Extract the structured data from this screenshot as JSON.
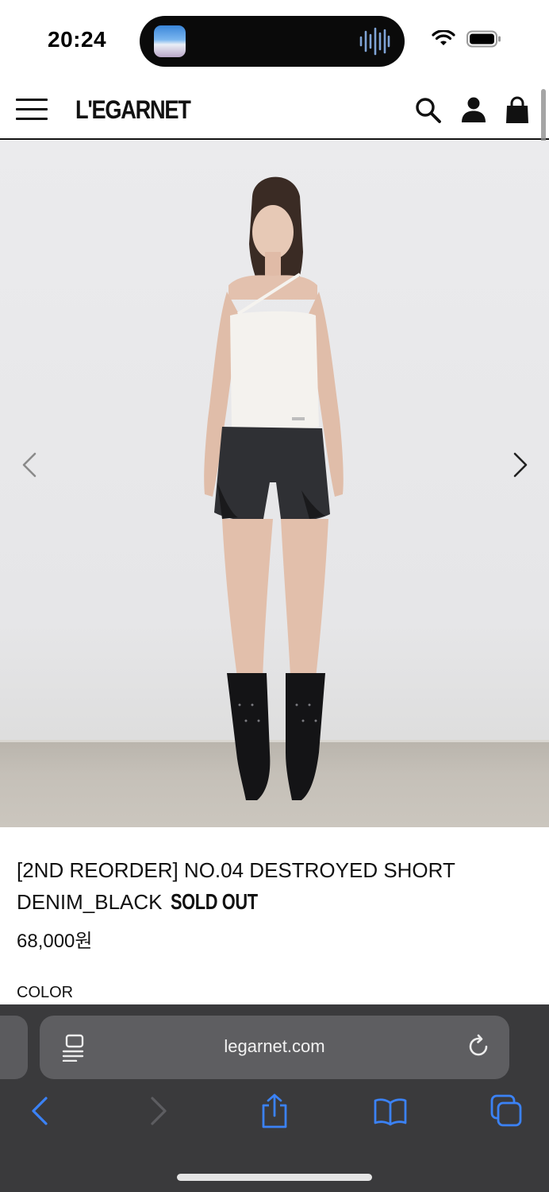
{
  "status_bar": {
    "time": "20:24"
  },
  "header": {
    "logo": "L'EGARNET"
  },
  "product": {
    "title": "[2ND REORDER] NO.04 DESTROYED SHORT DENIM_BLACK",
    "badge": "SOLD OUT",
    "price": "68,000원",
    "color_label": "COLOR"
  },
  "browser": {
    "url": "legarnet.com"
  },
  "icons": {
    "header": [
      "hamburger-menu-icon",
      "search-icon",
      "account-icon",
      "bag-icon"
    ],
    "carousel": [
      "chevron-left-icon",
      "chevron-right-icon"
    ],
    "toolbar": [
      "back-icon",
      "forward-icon",
      "share-icon",
      "bookmarks-icon",
      "tabs-icon"
    ]
  },
  "colors": {
    "browser_bg": "#3a3a3c",
    "browser_accent": "#3b82f6",
    "text": "#111111"
  }
}
